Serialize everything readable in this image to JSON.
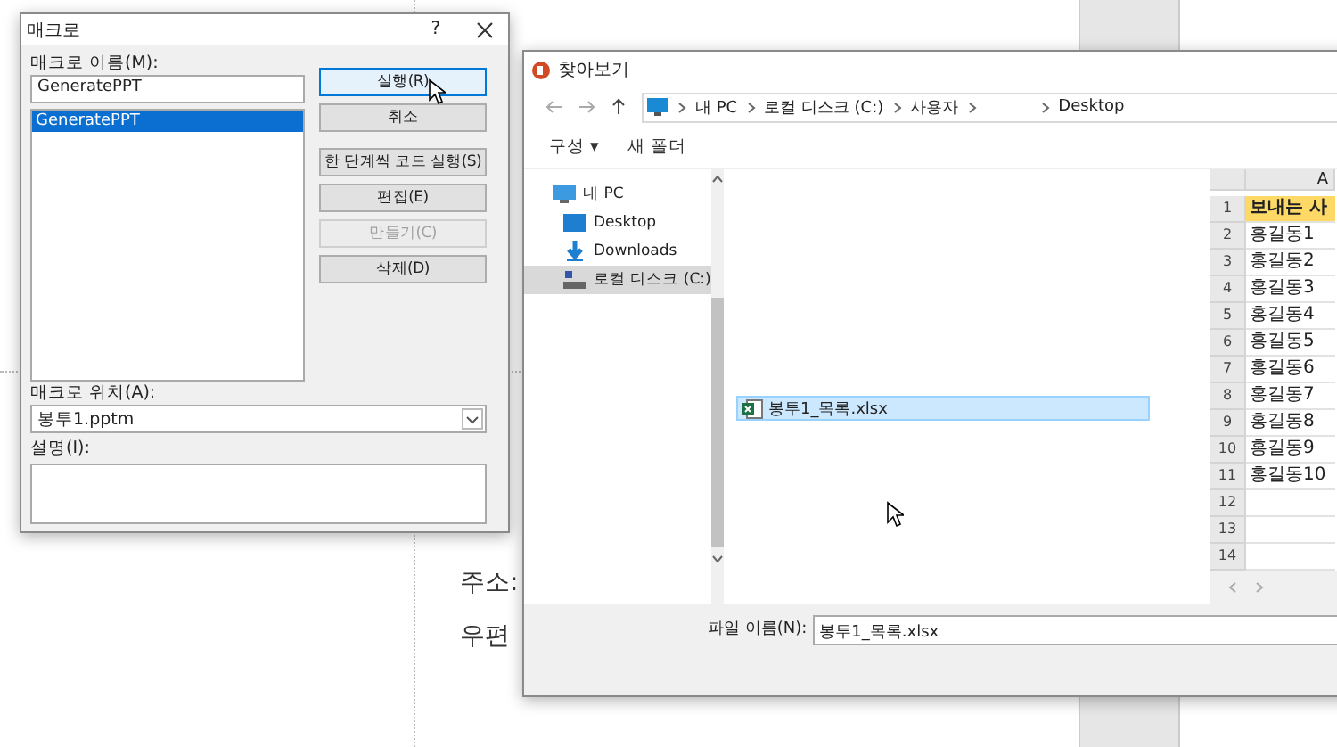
{
  "slide": {
    "texts": [
      "주소:",
      "우편"
    ]
  },
  "macro_dialog": {
    "title": "매크로",
    "help": "?",
    "name_label": "매크로 이름(M):",
    "name_value": "GeneratePPT",
    "macros": [
      {
        "name": "GeneratePPT",
        "selected": true
      }
    ],
    "buttons": [
      {
        "label": "실행(R)",
        "focused": true,
        "disabled": false
      },
      {
        "label": "취소",
        "focused": false,
        "disabled": false
      },
      {
        "label": "한 단계씩 코드 실행(S)",
        "focused": false,
        "disabled": false
      },
      {
        "label": "편집(E)",
        "focused": false,
        "disabled": false
      },
      {
        "label": "만들기(C)",
        "focused": false,
        "disabled": true
      },
      {
        "label": "삭제(D)",
        "focused": false,
        "disabled": false
      }
    ],
    "location_label": "매크로 위치(A):",
    "location_value": "봉투1.pptm",
    "description_label": "설명(I):"
  },
  "file_dialog": {
    "title": "찾아보기",
    "breadcrumb": [
      {
        "kind": "folder",
        "label": "내 PC"
      },
      {
        "kind": "folder",
        "label": "로컬 디스크 (C:)"
      },
      {
        "kind": "folder",
        "label": "사용자"
      },
      {
        "kind": "blank"
      },
      {
        "kind": "folder",
        "label": "Desktop"
      }
    ],
    "toolbar": [
      "구성 ▾",
      "새 폴더"
    ],
    "nav": [
      {
        "label": "내 PC",
        "kind": "pc",
        "selected": false,
        "children": [
          {
            "label": "Desktop",
            "kind": "desktop",
            "selected": false
          },
          {
            "label": "Downloads",
            "kind": "download",
            "selected": false
          },
          {
            "label": "로컬 디스크 (C:)",
            "kind": "disk",
            "selected": true
          }
        ]
      }
    ],
    "files": [
      {
        "name": "봉투1_목록.xlsx",
        "selected": true
      }
    ],
    "preview": {
      "column": "A",
      "rows": [
        {
          "num": "1",
          "value": "보내는 사",
          "header": true
        },
        {
          "num": "2",
          "value": "홍길동1",
          "header": false
        },
        {
          "num": "3",
          "value": "홍길동2",
          "header": false
        },
        {
          "num": "4",
          "value": "홍길동3",
          "header": false
        },
        {
          "num": "5",
          "value": "홍길동4",
          "header": false
        },
        {
          "num": "6",
          "value": "홍길동5",
          "header": false
        },
        {
          "num": "7",
          "value": "홍길동6",
          "header": false
        },
        {
          "num": "8",
          "value": "홍길동7",
          "header": false
        },
        {
          "num": "9",
          "value": "홍길동8",
          "header": false
        },
        {
          "num": "10",
          "value": "홍길동9",
          "header": false
        },
        {
          "num": "11",
          "value": "홍길동10",
          "header": false
        },
        {
          "num": "12",
          "header": false
        },
        {
          "num": "13",
          "header": false
        },
        {
          "num": "14",
          "header": false
        }
      ]
    },
    "filename_label": "파일 이름(N):",
    "filename_value": "봉투1_목록.xlsx"
  }
}
